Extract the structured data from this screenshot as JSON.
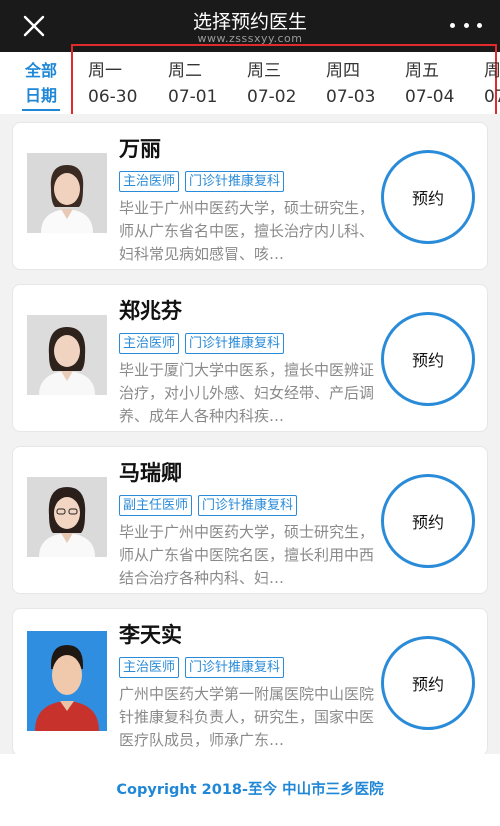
{
  "header": {
    "title": "选择预约医生",
    "subtitle": "www.zsssxyy.com"
  },
  "dates": {
    "all_label_line1": "全部",
    "all_label_line2": "日期",
    "days": [
      {
        "weekday": "周一",
        "date": "06-30"
      },
      {
        "weekday": "周二",
        "date": "07-01"
      },
      {
        "weekday": "周三",
        "date": "07-02"
      },
      {
        "weekday": "周四",
        "date": "07-03"
      },
      {
        "weekday": "周五",
        "date": "07-04"
      },
      {
        "weekday": "周",
        "date": "07"
      }
    ]
  },
  "doctors": [
    {
      "name": "万丽",
      "title": "主治医师",
      "dept": "门诊针推康复科",
      "intro": "毕业于广州中医药大学，硕士研究生，师从广东省名中医，擅长治疗内儿科、妇科常见病如感冒、咳…",
      "book": "预约"
    },
    {
      "name": "郑兆芬",
      "title": "主治医师",
      "dept": "门诊针推康复科",
      "intro": "毕业于厦门大学中医系，擅长中医辨证治疗，对小儿外感、妇女经带、产后调养、成年人各种内科疾…",
      "book": "预约"
    },
    {
      "name": "马瑞卿",
      "title": "副主任医师",
      "dept": "门诊针推康复科",
      "intro": "毕业于广州中医药大学，硕士研究生，师从广东省中医院名医，擅长利用中西结合治疗各种内科、妇…",
      "book": "预约"
    },
    {
      "name": "李天实",
      "title": "主治医师",
      "dept": "门诊针推康复科",
      "intro": "广州中医药大学第一附属医院中山医院针推康复科负责人，研究生，国家中医医疗队成员，师承广东…",
      "book": "预约"
    }
  ],
  "footer": {
    "copyright": "Copyright 2018-至今 中山市三乡医院"
  },
  "colors": {
    "accent": "#1f87d6",
    "highlight_box": "#e12a2a",
    "topbar_bg": "#1a1a1a"
  }
}
